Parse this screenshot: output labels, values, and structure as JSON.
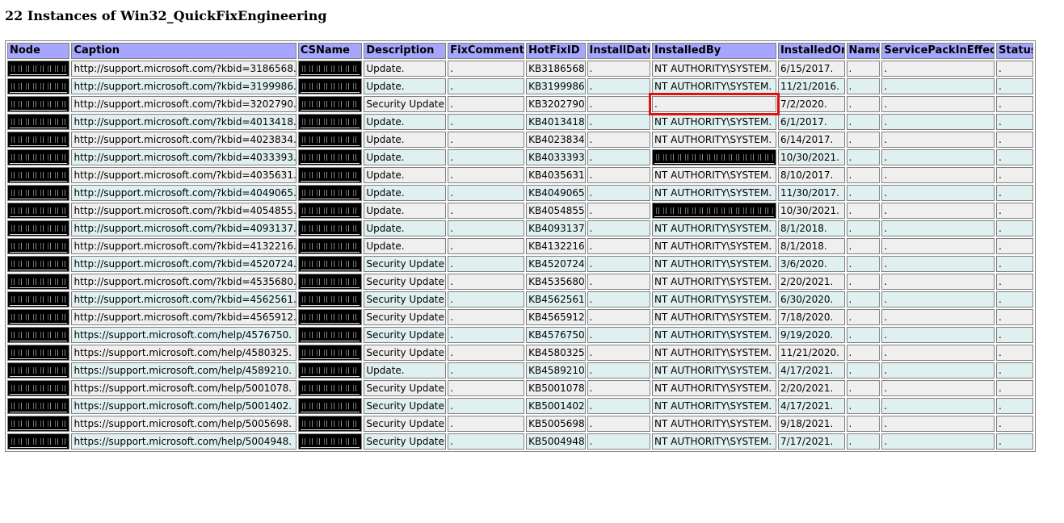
{
  "page": {
    "title": "22 Instances of Win32_QuickFixEngineering"
  },
  "table": {
    "columns": [
      "Node",
      "Caption",
      "CSName",
      "Description",
      "FixComments",
      "HotFixID",
      "InstallDate",
      "InstalledBy",
      "InstalledOn",
      "Name",
      "ServicePackInEffect",
      "Status"
    ],
    "redacted_columns": [
      "Node",
      "CSName"
    ],
    "highlighted_cell": {
      "row": 2,
      "column": "InstalledBy"
    },
    "rows": [
      {
        "caption": "http://support.microsoft.com/?kbid=3186568.",
        "description": "Update.",
        "fix_comments": ".",
        "hotfix_id": "KB3186568.",
        "install_date": ".",
        "installed_by": "NT AUTHORITY\\SYSTEM.",
        "installed_by_redacted": false,
        "installed_on": "6/15/2017.",
        "name": ".",
        "service_pack": ".",
        "status": "."
      },
      {
        "caption": "http://support.microsoft.com/?kbid=3199986.",
        "description": "Update.",
        "fix_comments": ".",
        "hotfix_id": "KB3199986.",
        "install_date": ".",
        "installed_by": "NT AUTHORITY\\SYSTEM.",
        "installed_by_redacted": false,
        "installed_on": "11/21/2016.",
        "name": ".",
        "service_pack": ".",
        "status": "."
      },
      {
        "caption": "http://support.microsoft.com/?kbid=3202790.",
        "description": "Security Update.",
        "fix_comments": ".",
        "hotfix_id": "KB3202790.",
        "install_date": ".",
        "installed_by": ".",
        "installed_by_redacted": false,
        "installed_on": "7/2/2020.",
        "name": ".",
        "service_pack": ".",
        "status": "."
      },
      {
        "caption": "http://support.microsoft.com/?kbid=4013418.",
        "description": "Update.",
        "fix_comments": ".",
        "hotfix_id": "KB4013418.",
        "install_date": ".",
        "installed_by": "NT AUTHORITY\\SYSTEM.",
        "installed_by_redacted": false,
        "installed_on": "6/1/2017.",
        "name": ".",
        "service_pack": ".",
        "status": "."
      },
      {
        "caption": "http://support.microsoft.com/?kbid=4023834.",
        "description": "Update.",
        "fix_comments": ".",
        "hotfix_id": "KB4023834.",
        "install_date": ".",
        "installed_by": "NT AUTHORITY\\SYSTEM.",
        "installed_by_redacted": false,
        "installed_on": "6/14/2017.",
        "name": ".",
        "service_pack": ".",
        "status": "."
      },
      {
        "caption": "http://support.microsoft.com/?kbid=4033393.",
        "description": "Update.",
        "fix_comments": ".",
        "hotfix_id": "KB4033393.",
        "install_date": ".",
        "installed_by": "",
        "installed_by_redacted": true,
        "installed_on": "10/30/2021.",
        "name": ".",
        "service_pack": ".",
        "status": "."
      },
      {
        "caption": "http://support.microsoft.com/?kbid=4035631.",
        "description": "Update.",
        "fix_comments": ".",
        "hotfix_id": "KB4035631.",
        "install_date": ".",
        "installed_by": "NT AUTHORITY\\SYSTEM.",
        "installed_by_redacted": false,
        "installed_on": "8/10/2017.",
        "name": ".",
        "service_pack": ".",
        "status": "."
      },
      {
        "caption": "http://support.microsoft.com/?kbid=4049065.",
        "description": "Update.",
        "fix_comments": ".",
        "hotfix_id": "KB4049065.",
        "install_date": ".",
        "installed_by": "NT AUTHORITY\\SYSTEM.",
        "installed_by_redacted": false,
        "installed_on": "11/30/2017.",
        "name": ".",
        "service_pack": ".",
        "status": "."
      },
      {
        "caption": "http://support.microsoft.com/?kbid=4054855.",
        "description": "Update.",
        "fix_comments": ".",
        "hotfix_id": "KB4054855.",
        "install_date": ".",
        "installed_by": "",
        "installed_by_redacted": true,
        "installed_on": "10/30/2021.",
        "name": ".",
        "service_pack": ".",
        "status": "."
      },
      {
        "caption": "http://support.microsoft.com/?kbid=4093137.",
        "description": "Update.",
        "fix_comments": ".",
        "hotfix_id": "KB4093137.",
        "install_date": ".",
        "installed_by": "NT AUTHORITY\\SYSTEM.",
        "installed_by_redacted": false,
        "installed_on": "8/1/2018.",
        "name": ".",
        "service_pack": ".",
        "status": "."
      },
      {
        "caption": "http://support.microsoft.com/?kbid=4132216.",
        "description": "Update.",
        "fix_comments": ".",
        "hotfix_id": "KB4132216.",
        "install_date": ".",
        "installed_by": "NT AUTHORITY\\SYSTEM.",
        "installed_by_redacted": false,
        "installed_on": "8/1/2018.",
        "name": ".",
        "service_pack": ".",
        "status": "."
      },
      {
        "caption": "http://support.microsoft.com/?kbid=4520724.",
        "description": "Security Update.",
        "fix_comments": ".",
        "hotfix_id": "KB4520724.",
        "install_date": ".",
        "installed_by": "NT AUTHORITY\\SYSTEM.",
        "installed_by_redacted": false,
        "installed_on": "3/6/2020.",
        "name": ".",
        "service_pack": ".",
        "status": "."
      },
      {
        "caption": "http://support.microsoft.com/?kbid=4535680.",
        "description": "Security Update.",
        "fix_comments": ".",
        "hotfix_id": "KB4535680.",
        "install_date": ".",
        "installed_by": "NT AUTHORITY\\SYSTEM.",
        "installed_by_redacted": false,
        "installed_on": "2/20/2021.",
        "name": ".",
        "service_pack": ".",
        "status": "."
      },
      {
        "caption": "http://support.microsoft.com/?kbid=4562561.",
        "description": "Security Update.",
        "fix_comments": ".",
        "hotfix_id": "KB4562561.",
        "install_date": ".",
        "installed_by": "NT AUTHORITY\\SYSTEM.",
        "installed_by_redacted": false,
        "installed_on": "6/30/2020.",
        "name": ".",
        "service_pack": ".",
        "status": "."
      },
      {
        "caption": "http://support.microsoft.com/?kbid=4565912.",
        "description": "Security Update.",
        "fix_comments": ".",
        "hotfix_id": "KB4565912.",
        "install_date": ".",
        "installed_by": "NT AUTHORITY\\SYSTEM.",
        "installed_by_redacted": false,
        "installed_on": "7/18/2020.",
        "name": ".",
        "service_pack": ".",
        "status": "."
      },
      {
        "caption": "https://support.microsoft.com/help/4576750.",
        "description": "Security Update.",
        "fix_comments": ".",
        "hotfix_id": "KB4576750.",
        "install_date": ".",
        "installed_by": "NT AUTHORITY\\SYSTEM.",
        "installed_by_redacted": false,
        "installed_on": "9/19/2020.",
        "name": ".",
        "service_pack": ".",
        "status": "."
      },
      {
        "caption": "https://support.microsoft.com/help/4580325.",
        "description": "Security Update.",
        "fix_comments": ".",
        "hotfix_id": "KB4580325.",
        "install_date": ".",
        "installed_by": "NT AUTHORITY\\SYSTEM.",
        "installed_by_redacted": false,
        "installed_on": "11/21/2020.",
        "name": ".",
        "service_pack": ".",
        "status": "."
      },
      {
        "caption": "https://support.microsoft.com/help/4589210.",
        "description": "Update.",
        "fix_comments": ".",
        "hotfix_id": "KB4589210.",
        "install_date": ".",
        "installed_by": "NT AUTHORITY\\SYSTEM.",
        "installed_by_redacted": false,
        "installed_on": "4/17/2021.",
        "name": ".",
        "service_pack": ".",
        "status": "."
      },
      {
        "caption": "https://support.microsoft.com/help/5001078.",
        "description": "Security Update.",
        "fix_comments": ".",
        "hotfix_id": "KB5001078.",
        "install_date": ".",
        "installed_by": "NT AUTHORITY\\SYSTEM.",
        "installed_by_redacted": false,
        "installed_on": "2/20/2021.",
        "name": ".",
        "service_pack": ".",
        "status": "."
      },
      {
        "caption": "https://support.microsoft.com/help/5001402.",
        "description": "Security Update.",
        "fix_comments": ".",
        "hotfix_id": "KB5001402.",
        "install_date": ".",
        "installed_by": "NT AUTHORITY\\SYSTEM.",
        "installed_by_redacted": false,
        "installed_on": "4/17/2021.",
        "name": ".",
        "service_pack": ".",
        "status": "."
      },
      {
        "caption": "https://support.microsoft.com/help/5005698.",
        "description": "Security Update.",
        "fix_comments": ".",
        "hotfix_id": "KB5005698.",
        "install_date": ".",
        "installed_by": "NT AUTHORITY\\SYSTEM.",
        "installed_by_redacted": false,
        "installed_on": "9/18/2021.",
        "name": ".",
        "service_pack": ".",
        "status": "."
      },
      {
        "caption": "https://support.microsoft.com/help/5004948.",
        "description": "Security Update.",
        "fix_comments": ".",
        "hotfix_id": "KB5004948.",
        "install_date": ".",
        "installed_by": "NT AUTHORITY\\SYSTEM.",
        "installed_by_redacted": false,
        "installed_on": "7/17/2021.",
        "name": ".",
        "service_pack": ".",
        "status": "."
      }
    ]
  },
  "colors": {
    "header_bg": "#a6a6ff",
    "row_odd_bg": "#efefef",
    "row_even_bg": "#e0f0f0",
    "highlight": "#e01010",
    "redaction": "#000000"
  }
}
